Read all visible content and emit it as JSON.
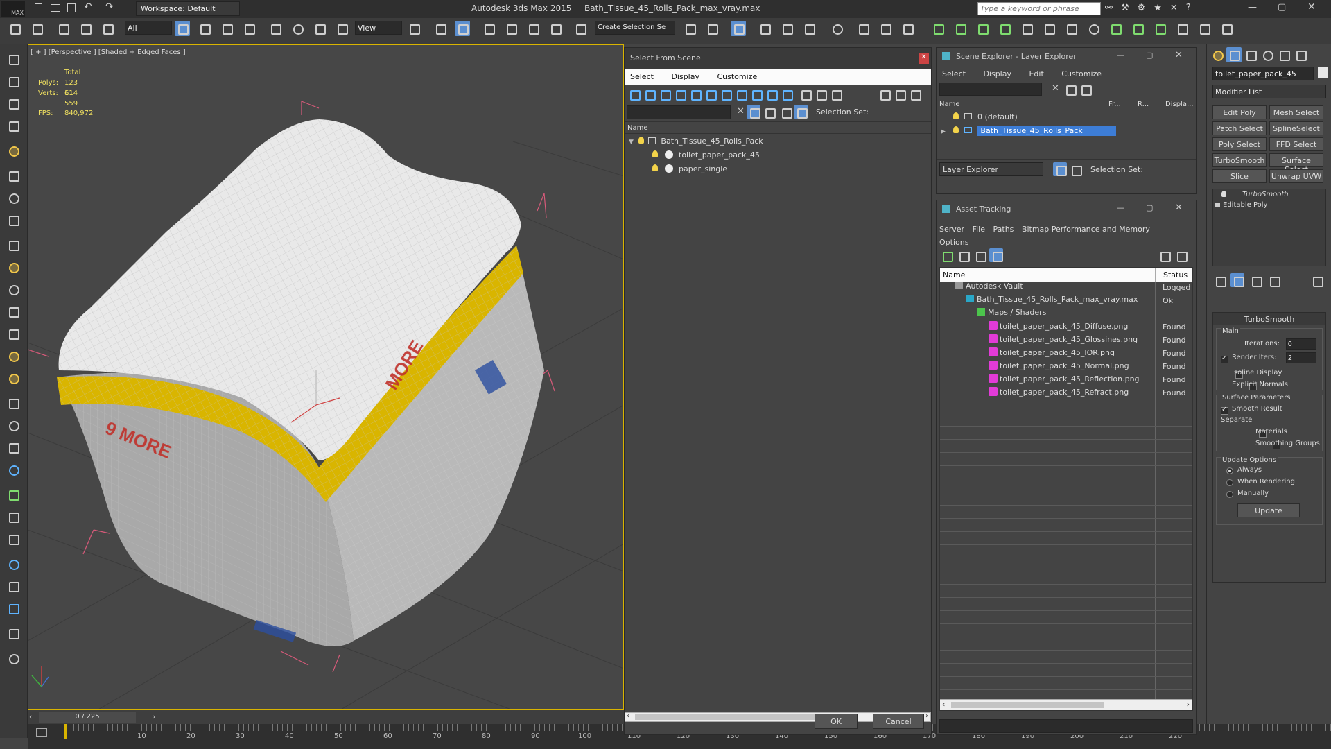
{
  "app": {
    "title": "Autodesk 3ds Max  2015",
    "file": "Bath_Tissue_45_Rolls_Pack_max_vray.max",
    "workspace": "Workspace: Default",
    "search_placeholder": "Type a keyword or phrase",
    "logo": "MAX"
  },
  "toolbar": {
    "filter": "All",
    "refcoord": "View",
    "selset": "Create Selection Se"
  },
  "viewport": {
    "label": "[ + ] [Perspective ] [Shaded + Edged Faces ]",
    "stats": {
      "total": "Total",
      "polys_label": "Polys:",
      "polys": "123 114",
      "verts_label": "Verts:",
      "verts": "61 559",
      "fps_label": "FPS:",
      "fps": "840,972"
    }
  },
  "timeline": {
    "frame": "0 / 225",
    "ticks": [
      "10",
      "20",
      "30",
      "40",
      "50",
      "60",
      "70",
      "80",
      "90",
      "100",
      "110",
      "120",
      "130",
      "140",
      "150",
      "160",
      "170",
      "180",
      "190",
      "200",
      "210",
      "220"
    ]
  },
  "select_from_scene": {
    "title": "Select From Scene",
    "menu": [
      "Select",
      "Display",
      "Customize"
    ],
    "selection_set": "Selection Set:",
    "col_name": "Name",
    "items": [
      {
        "label": "Bath_Tissue_45_Rolls_Pack",
        "level": 0
      },
      {
        "label": "toilet_paper_pack_45",
        "level": 1
      },
      {
        "label": "paper_single",
        "level": 1
      }
    ],
    "ok": "OK",
    "cancel": "Cancel"
  },
  "scene_explorer": {
    "title": "Scene Explorer - Layer Explorer",
    "menu": [
      "Select",
      "Display",
      "Edit",
      "Customize"
    ],
    "cols": [
      "Name",
      "Fr...",
      "R...",
      "Displa..."
    ],
    "layers": [
      "0 (default)",
      "Bath_Tissue_45_Rolls_Pack"
    ],
    "footer_dropdown": "Layer Explorer",
    "selection_set": "Selection Set:"
  },
  "asset_tracking": {
    "title": "Asset Tracking",
    "menu": [
      "Server",
      "File",
      "Paths",
      "Bitmap Performance and Memory"
    ],
    "menu2": "Options",
    "cols": [
      "Name",
      "Status"
    ],
    "rows": [
      {
        "name": "Autodesk Vault",
        "status": "Logged",
        "level": 0,
        "icon": "vault"
      },
      {
        "name": "Bath_Tissue_45_Rolls_Pack_max_vray.max",
        "status": "Ok",
        "level": 1,
        "icon": "max"
      },
      {
        "name": "Maps / Shaders",
        "status": "",
        "level": 2,
        "icon": "maps"
      },
      {
        "name": "toilet_paper_pack_45_Diffuse.png",
        "status": "Found",
        "level": 3,
        "icon": "png"
      },
      {
        "name": "toilet_paper_pack_45_Glossines.png",
        "status": "Found",
        "level": 3,
        "icon": "png"
      },
      {
        "name": "toilet_paper_pack_45_IOR.png",
        "status": "Found",
        "level": 3,
        "icon": "png"
      },
      {
        "name": "toilet_paper_pack_45_Normal.png",
        "status": "Found",
        "level": 3,
        "icon": "png"
      },
      {
        "name": "toilet_paper_pack_45_Reflection.png",
        "status": "Found",
        "level": 3,
        "icon": "png"
      },
      {
        "name": "toilet_paper_pack_45_Refract.png",
        "status": "Found",
        "level": 3,
        "icon": "png"
      }
    ]
  },
  "modify_panel": {
    "object_name": "toilet_paper_pack_45",
    "modifier_list": "Modifier List",
    "buttons": [
      "Edit Poly",
      "Mesh Select",
      "Patch Select",
      "SplineSelect",
      "Poly Select",
      "FFD Select",
      "TurboSmooth",
      "Surface Select",
      "Slice",
      "Unwrap UVW"
    ],
    "stack": [
      "TurboSmooth",
      "Editable Poly"
    ],
    "rollout": {
      "title": "TurboSmooth",
      "main": "Main",
      "iterations_label": "Iterations:",
      "iterations": "0",
      "render_iters_label": "Render Iters:",
      "render_iters": "2",
      "isoline": "Isoline Display",
      "explicit": "Explicit Normals",
      "surface": "Surface Parameters",
      "smooth": "Smooth Result",
      "separate": "Separate",
      "materials": "Materials",
      "smoothing_groups": "Smoothing Groups",
      "update_options": "Update Options",
      "always": "Always",
      "when_rendering": "When Rendering",
      "manually": "Manually",
      "update": "Update"
    }
  }
}
